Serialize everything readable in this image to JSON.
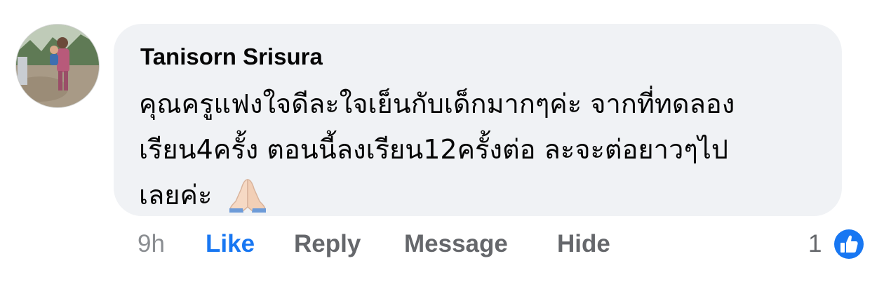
{
  "comment": {
    "author": "Tanisorn Srisura",
    "lines": [
      "คุณครูแฟงใจดีละใจเย็นกับเด็กมากๆค่ะ  จากที่ทดลอง",
      "เรียน4ครั้ง ตอนนี้ลงเรียน12ครั้งต่อ ละจะต่อยาวๆไป",
      "เลยค่ะ"
    ],
    "emoji": "folded-hands",
    "avatar_icon": "user-avatar-photo"
  },
  "actions": {
    "time": "9h",
    "like_label": "Like",
    "reply_label": "Reply",
    "message_label": "Message",
    "hide_label": "Hide",
    "reaction_count": "1",
    "reaction_icon": "thumbs-up-icon"
  },
  "colors": {
    "bubble": "#f0f2f5",
    "like_active": "#1877f2",
    "action_text": "#65676b",
    "time_text": "#8a8d91"
  }
}
